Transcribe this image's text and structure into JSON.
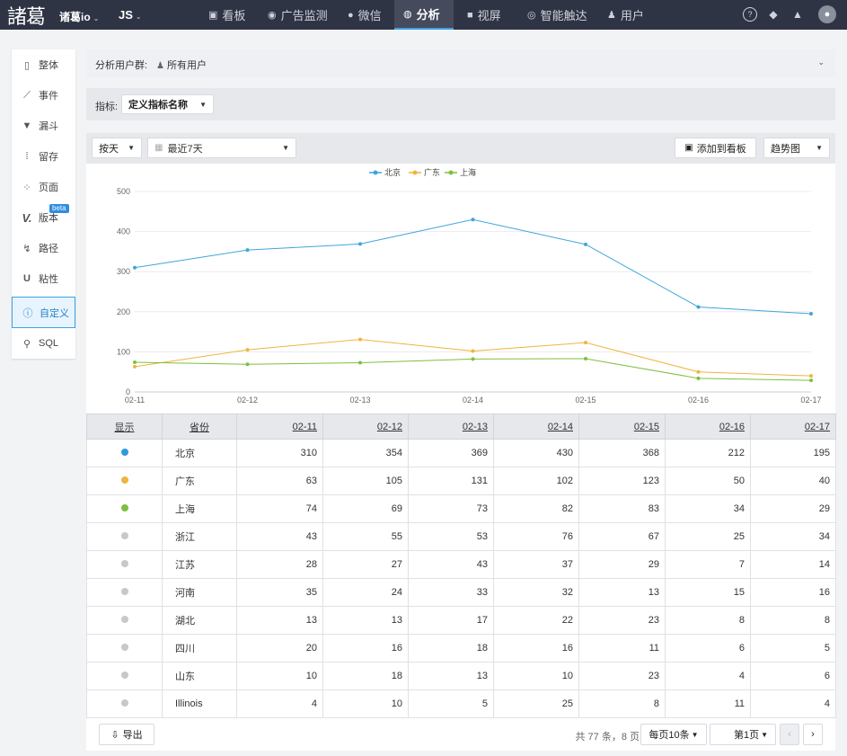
{
  "topbar": {
    "logo": "諸葛",
    "project": "诸葛io",
    "sdk": "JS",
    "nav": [
      {
        "label": "看板",
        "icon": "dashboard-icon",
        "glyph": "▣"
      },
      {
        "label": "广告监测",
        "icon": "ad-monitor-icon",
        "glyph": "◉"
      },
      {
        "label": "微信",
        "icon": "wechat-icon",
        "glyph": "●"
      },
      {
        "label": "分析",
        "icon": "analysis-icon",
        "glyph": "◍"
      },
      {
        "label": "视屏",
        "icon": "video-icon",
        "glyph": "■"
      },
      {
        "label": "智能触达",
        "icon": "smart-reach-icon",
        "glyph": "◎"
      },
      {
        "label": "用户",
        "icon": "user-icon",
        "glyph": "♟"
      }
    ],
    "right_icons": [
      "help-icon",
      "diamond-icon",
      "notification-icon",
      "avatar"
    ]
  },
  "sidebar": {
    "items": [
      {
        "label": "整体",
        "icon": "overview-icon",
        "glyph": "▯"
      },
      {
        "label": "事件",
        "icon": "event-icon",
        "glyph": "⟋"
      },
      {
        "label": "漏斗",
        "icon": "funnel-icon",
        "glyph": "▼"
      },
      {
        "label": "留存",
        "icon": "retention-icon",
        "glyph": "⁞"
      },
      {
        "label": "页面",
        "icon": "page-icon",
        "glyph": "⁘"
      },
      {
        "label": "版本",
        "icon": "version-icon",
        "glyph": "V."
      },
      {
        "label": "路径",
        "icon": "path-icon",
        "glyph": "↯"
      },
      {
        "label": "粘性",
        "icon": "stickiness-icon",
        "glyph": "U"
      },
      {
        "label": "自定义",
        "icon": "custom-icon",
        "glyph": "ⓘ"
      },
      {
        "label": "SQL",
        "icon": "sql-icon",
        "glyph": "⚲"
      }
    ],
    "beta_badge": "beta",
    "active_index": 8
  },
  "user_group": {
    "label": "分析用户群:",
    "value": "所有用户"
  },
  "metric": {
    "label": "指标:",
    "value": "定义指标名称"
  },
  "toolbar": {
    "granularity": "按天",
    "date_range": "最近7天",
    "add_to_dashboard": "添加到看板",
    "chart_type": "趋势图"
  },
  "chart_data": {
    "type": "line",
    "x": [
      "02-11",
      "02-12",
      "02-13",
      "02-14",
      "02-15",
      "02-16",
      "02-17"
    ],
    "ylim": [
      0,
      500
    ],
    "yticks": [
      0,
      100,
      200,
      300,
      400,
      500
    ],
    "grid": true,
    "legend": "top-center",
    "series": [
      {
        "name": "北京",
        "color": "#3ea6db",
        "values": [
          310,
          354,
          369,
          430,
          368,
          212,
          195
        ]
      },
      {
        "name": "广东",
        "color": "#f0b43c",
        "values": [
          63,
          105,
          131,
          102,
          123,
          50,
          40
        ]
      },
      {
        "name": "上海",
        "color": "#7fbf3f",
        "values": [
          74,
          69,
          73,
          82,
          83,
          34,
          29
        ]
      }
    ]
  },
  "table": {
    "headers": [
      "显示",
      "省份",
      "02-11",
      "02-12",
      "02-13",
      "02-14",
      "02-15",
      "02-16",
      "02-17"
    ],
    "rows": [
      {
        "province": "北京",
        "color": "#2d9ae0",
        "values": [
          310,
          354,
          369,
          430,
          368,
          212,
          195
        ]
      },
      {
        "province": "广东",
        "color": "#f0b43c",
        "values": [
          63,
          105,
          131,
          102,
          123,
          50,
          40
        ]
      },
      {
        "province": "上海",
        "color": "#7fbf3f",
        "values": [
          74,
          69,
          73,
          82,
          83,
          34,
          29
        ]
      },
      {
        "province": "浙江",
        "color": "#c8c8c8",
        "values": [
          43,
          55,
          53,
          76,
          67,
          25,
          34
        ]
      },
      {
        "province": "江苏",
        "color": "#c8c8c8",
        "values": [
          28,
          27,
          43,
          37,
          29,
          7,
          14
        ]
      },
      {
        "province": "河南",
        "color": "#c8c8c8",
        "values": [
          35,
          24,
          33,
          32,
          13,
          15,
          16
        ]
      },
      {
        "province": "湖北",
        "color": "#c8c8c8",
        "values": [
          13,
          13,
          17,
          22,
          23,
          8,
          8
        ]
      },
      {
        "province": "四川",
        "color": "#c8c8c8",
        "values": [
          20,
          16,
          18,
          16,
          11,
          6,
          5
        ]
      },
      {
        "province": "山东",
        "color": "#c8c8c8",
        "values": [
          10,
          18,
          13,
          10,
          23,
          4,
          6
        ]
      },
      {
        "province": "Illinois",
        "color": "#c8c8c8",
        "values": [
          4,
          10,
          5,
          25,
          8,
          11,
          4
        ]
      }
    ]
  },
  "footer": {
    "export": "导出",
    "summary": "共 77 条，8 页",
    "page_size": "每页10条",
    "current_page": "第1页",
    "prev": "‹",
    "next": "›"
  }
}
